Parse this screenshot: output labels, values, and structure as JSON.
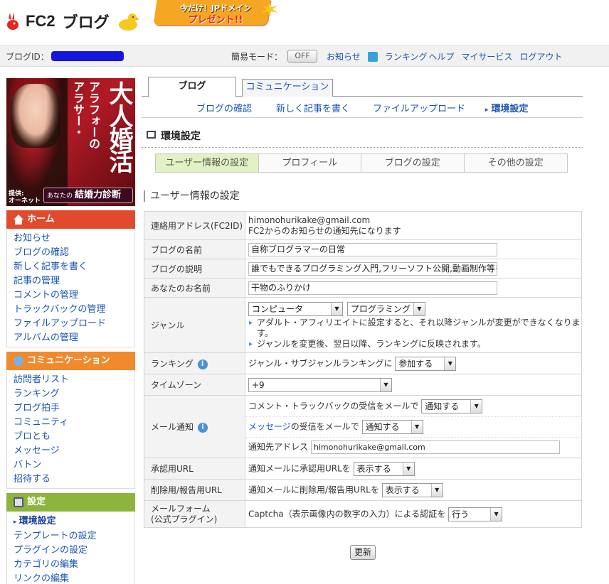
{
  "header": {
    "logo_text": "FC2",
    "logo_sub": "ブログ",
    "promo_line1": "今だけ！JPドメイン",
    "promo_line2": "プレゼント!!"
  },
  "account_bar": {
    "blog_id_label": "ブログID：",
    "simple_mode_label": "簡易モード：",
    "simple_mode_value": "OFF",
    "links": [
      "お知らせ",
      "ランキング",
      "ヘルプ",
      "マイサービス",
      "ログアウト"
    ]
  },
  "ad": {
    "line1": "アラサー・",
    "line2": "アラフォーの",
    "line3": "大人婚活",
    "provider": "提供:\nオーネット",
    "cta_small": "あなたの",
    "cta": "結婚力診断"
  },
  "sidebar": {
    "sections": [
      {
        "title": "ホーム",
        "color": "#e14a2c",
        "items": [
          "お知らせ",
          "ブログの確認",
          "新しく記事を書く",
          "記事の管理",
          "コメントの管理",
          "トラックバックの管理",
          "ファイルアップロード",
          "アルバムの管理"
        ]
      },
      {
        "title": "コミュニケーション",
        "color": "#f08a2c",
        "items": [
          "訪問者リスト",
          "ランキング",
          "ブログ拍手",
          "コミュニティ",
          "ブロとも",
          "メッセージ",
          "バトン",
          "招待する"
        ]
      },
      {
        "title": "設定",
        "color": "#8db43c",
        "items": [
          "環境設定",
          "テンプレートの設定",
          "プラグインの設定",
          "カテゴリの編集",
          "リンクの編集"
        ]
      }
    ]
  },
  "tabs": {
    "blog": "ブログ",
    "communication": "コミュニケーション"
  },
  "subnav": [
    "ブログの確認",
    "新しく記事を書く",
    "ファイルアップロード",
    "環境設定"
  ],
  "page_title": "環境設定",
  "settings_tabs": [
    "ユーザー情報の設定",
    "プロフィール",
    "ブログの設定",
    "その他の設定"
  ],
  "section_title": "ユーザー情報の設定",
  "form": {
    "contact_label": "連絡用アドレス(FC2ID)",
    "contact_email": "himonohurikake@gmail.com",
    "contact_note": "FC2からのお知らせの通知先になります",
    "blog_name_label": "ブログの名前",
    "blog_name_value": "自称ブログラマーの日常",
    "blog_desc_label": "ブログの説明",
    "blog_desc_value": "誰でもできるプログラミング入門,フリーソフト公開,動画制作等をメイン",
    "your_name_label": "あなたのお名前",
    "your_name_value": "干物のふりかけ",
    "genre_label": "ジャンル",
    "genre_value": "コンピュータ",
    "subgenre_value": "プログラミング",
    "genre_note1": "アダルト・アフィリエイトに設定すると、それ以降ジャンルが変更ができなくなります。",
    "genre_note2": "ジャンルを変更後、翌日以降、ランキングに反映されます。",
    "ranking_label": "ランキング",
    "ranking_text": "ジャンル・サブジャンルランキングに",
    "ranking_value": "参加する",
    "timezone_label": "タイムゾーン",
    "timezone_value": "+9",
    "mail_label": "メール通知",
    "mail_comment_text": "コメント・トラックバックの受信をメールで",
    "mail_comment_value": "通知する",
    "mail_message_link": "メッセージ",
    "mail_message_text": "の受信をメールで",
    "mail_message_value": "通知する",
    "mail_address_label": "通知先アドレス",
    "mail_address_value": "himonohurikake@gmail.com",
    "approve_label": "承認用URL",
    "approve_text": "通知メールに承認用URLを",
    "approve_value": "表示する",
    "delete_label": "削除用/報告用URL",
    "delete_text": "通知メールに削除用/報告用URLを",
    "delete_value": "表示する",
    "mailform_label1": "メールフォーム",
    "mailform_label2": "(公式プラグイン)",
    "captcha_text": "Captcha（表示画像内の数字の入力）による認証を",
    "captcha_value": "行う"
  },
  "update_button": "更新"
}
